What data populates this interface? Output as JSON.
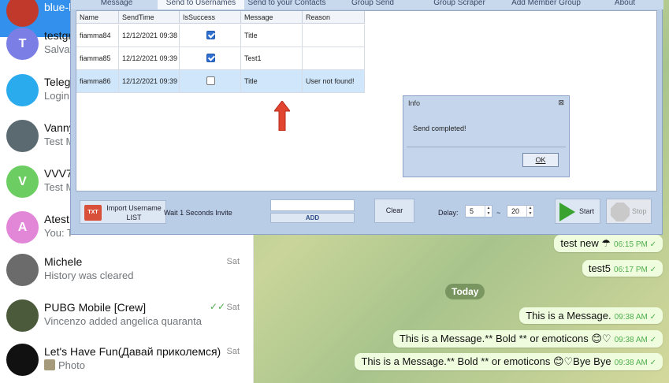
{
  "telegram": {
    "chats": [
      {
        "name": "blue-h",
        "subtitle": "",
        "time": "",
        "avatar_letter": "",
        "avatar_color": "#c0392b",
        "active": true
      },
      {
        "name": "testgr",
        "subtitle": "Salvat",
        "time": "",
        "avatar_letter": "T",
        "avatar_color": "#7b7fe5"
      },
      {
        "name": "Telegr",
        "subtitle": "Login",
        "time": "",
        "avatar_letter": "",
        "avatar_color": "#2aabee"
      },
      {
        "name": "Vanny",
        "subtitle": "Test M",
        "time": "",
        "avatar_letter": "",
        "avatar_color": "#5a6a70"
      },
      {
        "name": "VVV7",
        "subtitle": "Test M",
        "time": "",
        "avatar_letter": "V",
        "avatar_color": "#6ccd63"
      },
      {
        "name": "Atest",
        "subtitle": "You: T",
        "time": "",
        "avatar_letter": "A",
        "avatar_color": "#e286d8"
      },
      {
        "name": "Michele",
        "subtitle": "History was cleared",
        "time": "Sat",
        "avatar_letter": "",
        "avatar_color": "#6b6b6b"
      },
      {
        "name": "PUBG Mobile [Crew]",
        "subtitle": "Vincenzo added angelica quaranta",
        "time": "Sat",
        "avatar_letter": "",
        "avatar_color": "#4a5a3a",
        "ticks": "✓✓"
      },
      {
        "name": "Let's Have Fun(Давай приколемся)",
        "subtitle": "Photo",
        "time": "Sat",
        "avatar_letter": "",
        "avatar_color": "#111111"
      }
    ],
    "messages": [
      {
        "text": "test new ☂",
        "time": "06:15 PM ✓"
      },
      {
        "text": "test5",
        "time": "06:17 PM ✓"
      },
      {
        "text": "This is a Message.",
        "time": "09:38 AM ✓"
      },
      {
        "text": "This is a Message.** Bold ** or emoticons 😊♡",
        "time": "09:38 AM ✓"
      },
      {
        "text": "This is a Message.** Bold ** or emoticons 😊♡Bye Bye",
        "time": "09:38 AM ✓"
      }
    ],
    "today_label": "Today"
  },
  "tool": {
    "tabs": [
      "Message",
      "Send to Usernames",
      "Send to your Contacts",
      "Group Send",
      "Group Scraper",
      "Add Member Group",
      "About"
    ],
    "selected_tab": 1,
    "grid": {
      "columns": [
        "Name",
        "SendTime",
        "IsSuccess",
        "Message",
        "Reason"
      ],
      "rows": [
        {
          "name": "fiamma84",
          "send_time": "12/12/2021 09:38",
          "is_success": true,
          "message": "Title",
          "reason": ""
        },
        {
          "name": "fiamma85",
          "send_time": "12/12/2021 09:39",
          "is_success": true,
          "message": "Test1",
          "reason": ""
        },
        {
          "name": "fiamma86",
          "send_time": "12/12/2021 09:39",
          "is_success": false,
          "message": "Title",
          "reason": "User not found!"
        }
      ]
    },
    "dialog": {
      "title": "Info",
      "close": "⊠",
      "message": "Send completed!",
      "ok_label": "OK"
    },
    "toolbar": {
      "import_icon_text": "TXT",
      "import_label": "Import Username LIST",
      "invite_label": "Wait 1 Seconds Invite",
      "add_label": "ADD",
      "clear_label": "Clear",
      "delay_label": "Delay:",
      "delay_min": "5",
      "delay_sep": "~",
      "delay_max": "20",
      "start_label": "Start",
      "stop_label": "Stop"
    }
  }
}
